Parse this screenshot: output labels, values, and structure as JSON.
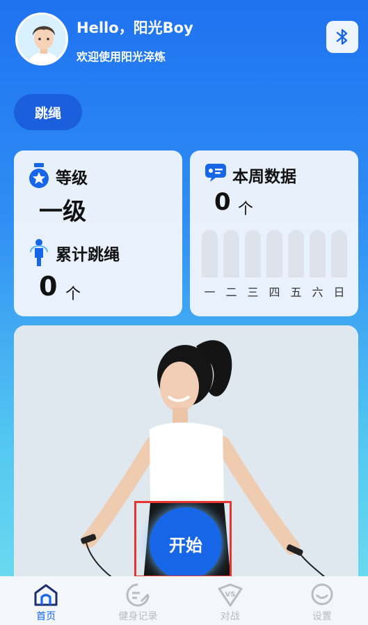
{
  "header": {
    "greeting": "Hello，阳光Boy",
    "welcome": "欢迎使用阳光淬炼"
  },
  "tag": {
    "label": "跳绳"
  },
  "stats": {
    "level_title": "等级",
    "level_value": "一级",
    "total_title": "累计跳绳",
    "total_value": "0",
    "total_unit": "个"
  },
  "weekly": {
    "title": "本周数据",
    "value": "0",
    "unit": "个",
    "days": [
      "一",
      "二",
      "三",
      "四",
      "五",
      "六",
      "日"
    ],
    "counts": [
      0,
      0,
      0,
      0,
      0,
      0,
      0
    ]
  },
  "start_button": {
    "label": "开始"
  },
  "nav": {
    "items": [
      {
        "label": "首页",
        "icon": "home-icon",
        "active": true
      },
      {
        "label": "健身记录",
        "icon": "record-icon",
        "active": false
      },
      {
        "label": "对战",
        "icon": "vs-icon",
        "active": false
      },
      {
        "label": "设置",
        "icon": "settings-face-icon",
        "active": false
      }
    ]
  },
  "colors": {
    "primary": "#1766e8",
    "highlight_border": "#e8342f"
  }
}
